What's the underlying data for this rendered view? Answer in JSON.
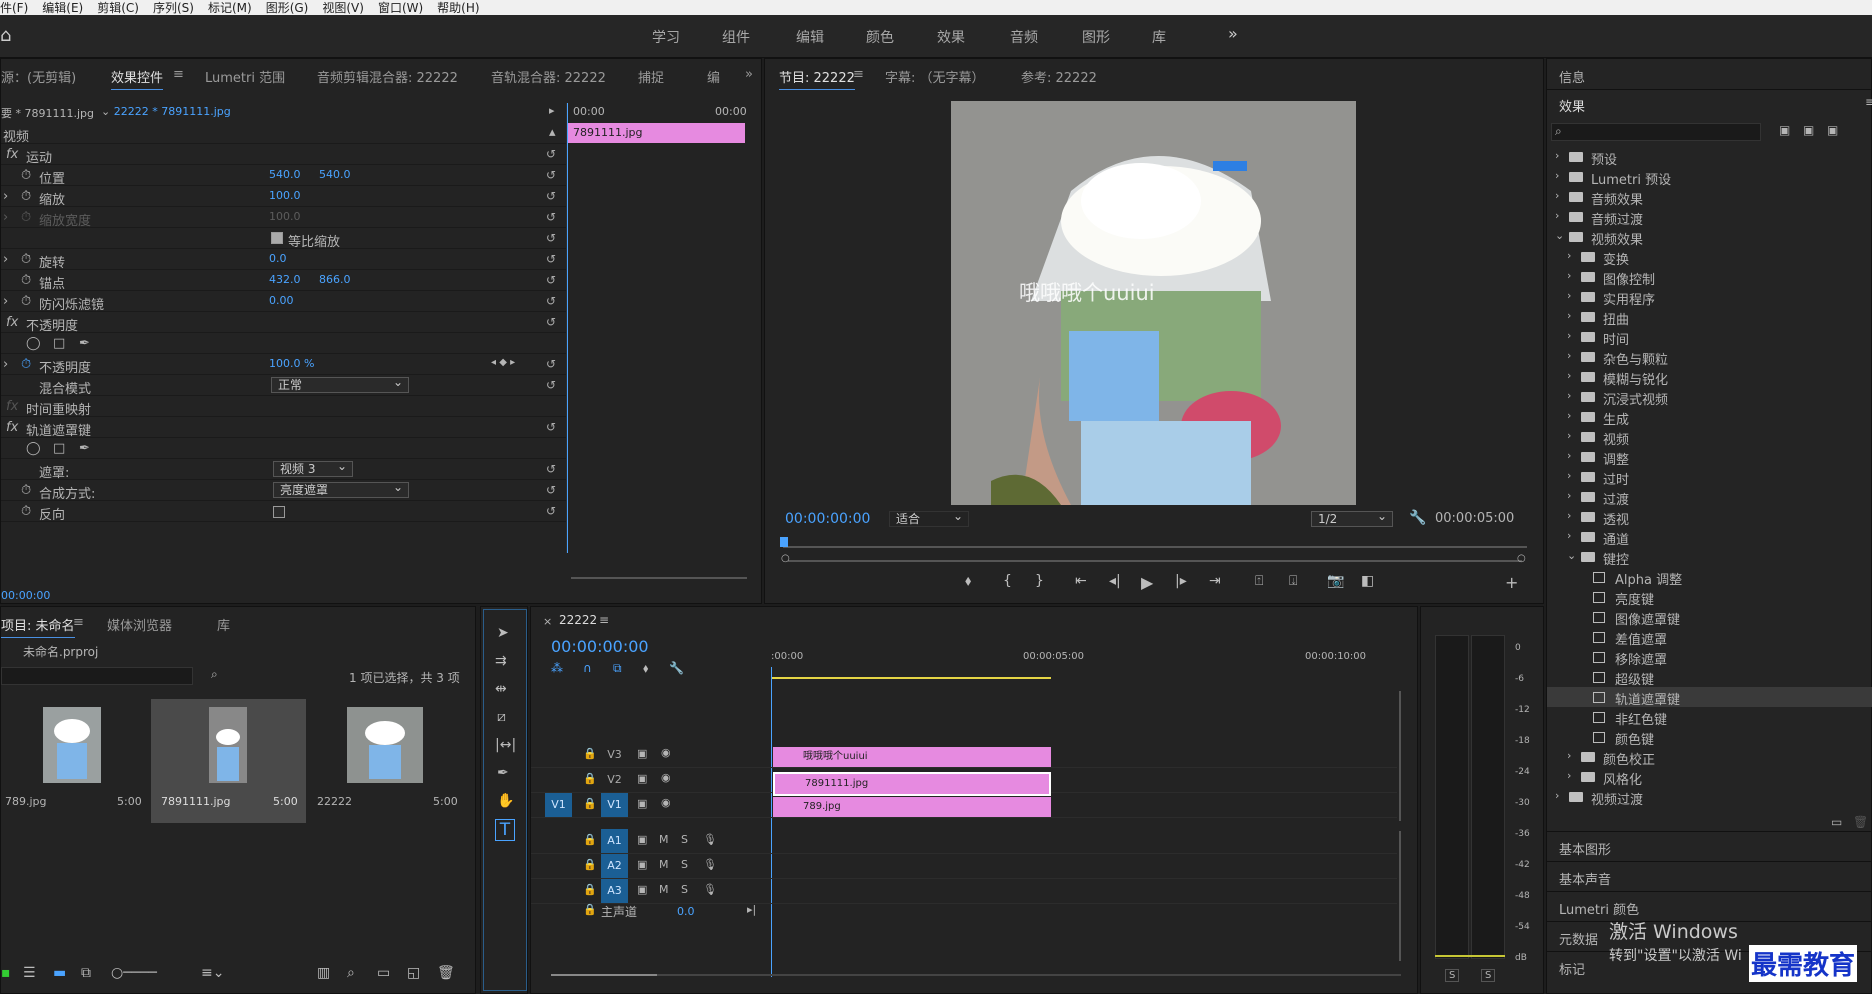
{
  "menu": [
    "件(F)",
    "编辑(E)",
    "剪辑(C)",
    "序列(S)",
    "标记(M)",
    "图形(G)",
    "视图(V)",
    "窗口(W)",
    "帮助(H)"
  ],
  "workspaces": [
    "学习",
    "组件",
    "编辑",
    "颜色",
    "效果",
    "音频",
    "图形",
    "库"
  ],
  "effect_controls": {
    "tabs": [
      "源：(无剪辑)",
      "效果控件",
      "Lumetri 范围",
      "音频剪辑混合器: 22222",
      "音轨混合器: 22222",
      "捕捉",
      "编"
    ],
    "source_label": "要 * 7891111.jpg",
    "sequence_label": "22222 * 7891111.jpg",
    "section_video": "视频",
    "motion": "运动",
    "position": "位置",
    "position_x": "540.0",
    "position_y": "540.0",
    "scale": "缩放",
    "scale_val": "100.0",
    "scale_width": "缩放宽度",
    "scale_width_val": "100.0",
    "uniform_scale": "等比缩放",
    "rotation": "旋转",
    "rotation_val": "0.0",
    "anchor": "锚点",
    "anchor_x": "432.0",
    "anchor_y": "866.0",
    "antiflicker": "防闪烁滤镜",
    "antiflicker_val": "0.00",
    "opacity_section": "不透明度",
    "opacity": "不透明度",
    "opacity_val": "100.0 %",
    "blend_mode": "混合模式",
    "blend_val": "正常",
    "time_remap": "时间重映射",
    "track_matte": "轨道遮罩键",
    "matte": "遮罩:",
    "matte_val": "视频 3",
    "composite": "合成方式:",
    "composite_val": "亮度遮罩",
    "reverse": "反向",
    "timecode": "00:00:00",
    "mini_start": "00:00",
    "mini_end": "00:00",
    "mini_clip": "7891111.jpg"
  },
  "program": {
    "tabs": [
      "节目: 22222",
      "字幕: （无字幕）",
      "参考: 22222"
    ],
    "overlay_text": "哦哦哦个uuiui",
    "timecode": "00:00:00:00",
    "fit": "适合",
    "resolution": "1/2",
    "duration": "00:00:05:00"
  },
  "right": {
    "info": "信息",
    "effects": "效果",
    "tree": [
      {
        "label": "预设",
        "indent": 0,
        "type": "folder2"
      },
      {
        "label": "Lumetri 预设",
        "indent": 0,
        "type": "folder2"
      },
      {
        "label": "音频效果",
        "indent": 0,
        "type": "folder"
      },
      {
        "label": "音频过渡",
        "indent": 0,
        "type": "folder"
      },
      {
        "label": "视频效果",
        "indent": 0,
        "type": "folder",
        "open": true
      },
      {
        "label": "变换",
        "indent": 1,
        "type": "folder"
      },
      {
        "label": "图像控制",
        "indent": 1,
        "type": "folder"
      },
      {
        "label": "实用程序",
        "indent": 1,
        "type": "folder"
      },
      {
        "label": "扭曲",
        "indent": 1,
        "type": "folder"
      },
      {
        "label": "时间",
        "indent": 1,
        "type": "folder"
      },
      {
        "label": "杂色与颗粒",
        "indent": 1,
        "type": "folder"
      },
      {
        "label": "模糊与锐化",
        "indent": 1,
        "type": "folder"
      },
      {
        "label": "沉浸式视频",
        "indent": 1,
        "type": "folder"
      },
      {
        "label": "生成",
        "indent": 1,
        "type": "folder"
      },
      {
        "label": "视频",
        "indent": 1,
        "type": "folder"
      },
      {
        "label": "调整",
        "indent": 1,
        "type": "folder"
      },
      {
        "label": "过时",
        "indent": 1,
        "type": "folder"
      },
      {
        "label": "过渡",
        "indent": 1,
        "type": "folder"
      },
      {
        "label": "透视",
        "indent": 1,
        "type": "folder"
      },
      {
        "label": "通道",
        "indent": 1,
        "type": "folder"
      },
      {
        "label": "键控",
        "indent": 1,
        "type": "folder",
        "open": true
      },
      {
        "label": "Alpha 调整",
        "indent": 2,
        "type": "preset"
      },
      {
        "label": "亮度键",
        "indent": 2,
        "type": "preset"
      },
      {
        "label": "图像遮罩键",
        "indent": 2,
        "type": "preset"
      },
      {
        "label": "差值遮罩",
        "indent": 2,
        "type": "preset"
      },
      {
        "label": "移除遮罩",
        "indent": 2,
        "type": "preset"
      },
      {
        "label": "超级键",
        "indent": 2,
        "type": "preset"
      },
      {
        "label": "轨道遮罩键",
        "indent": 2,
        "type": "preset",
        "selected": true
      },
      {
        "label": "非红色键",
        "indent": 2,
        "type": "preset"
      },
      {
        "label": "颜色键",
        "indent": 2,
        "type": "preset"
      },
      {
        "label": "颜色校正",
        "indent": 1,
        "type": "folder"
      },
      {
        "label": "风格化",
        "indent": 1,
        "type": "folder"
      },
      {
        "label": "视频过渡",
        "indent": 0,
        "type": "folder"
      }
    ],
    "panels": [
      "基本图形",
      "基本声音",
      "Lumetri 颜色",
      "元数据",
      "标记"
    ],
    "activate_title": "激活 Windows",
    "activate_sub": "转到\"设置\"以激活 Wi",
    "watermark": "最需教育"
  },
  "project": {
    "tabs": [
      "项目: 未命名",
      "媒体浏览器",
      "库"
    ],
    "file": "未命名.prproj",
    "selection": "1 项已选择，共 3 项",
    "items": [
      {
        "name": "789.jpg",
        "dur": "5:00"
      },
      {
        "name": "7891111.jpg",
        "dur": "5:00"
      },
      {
        "name": "22222",
        "dur": "5:00"
      }
    ]
  },
  "timeline": {
    "tab": "22222",
    "timecode": "00:00:00:00",
    "ruler": [
      ":00:00",
      "00:00:05:00",
      "00:00:10:00"
    ],
    "tracks": [
      "V3",
      "V2",
      "V1",
      "A1",
      "A2",
      "A3"
    ],
    "master": "主声道",
    "master_val": "0.0",
    "clips": [
      "哦哦哦个uuiui",
      "7891111.jpg",
      "789.jpg"
    ],
    "source_patch": "V1"
  },
  "meter": {
    "labels": [
      "0",
      "-6",
      "-12",
      "-18",
      "-24",
      "-30",
      "-36",
      "-42",
      "-48",
      "-54",
      "dB"
    ],
    "solo": "S"
  },
  "colors": {
    "accent": "#4aa3ff",
    "clip": "#e68ae0",
    "selected": "#3a3a3a"
  }
}
